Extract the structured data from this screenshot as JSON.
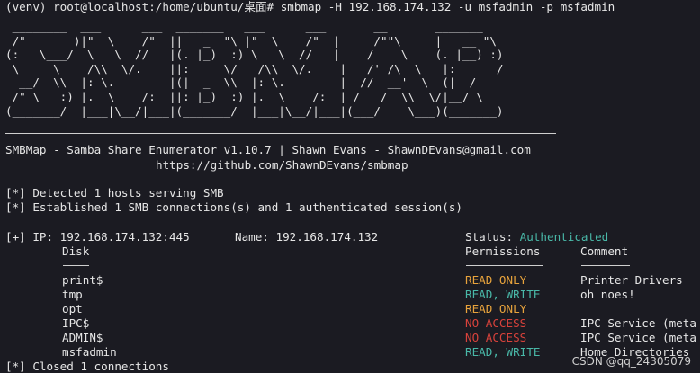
{
  "terminal": {
    "command_line": "(venv) root@localhost:/home/ubuntu/桌面# smbmap -H 192.168.174.132 -u msfadmin -p msfadmin",
    "banner_art": " ________  ___      ___  _______   ___      ___       __       _______\n /\"       )|\"  \\    /\"  ||   _  \"\\ |\"  \\    /\"  |     /\"\"\\     |   __ \"\\\n(:   \\___/  \\   \\  //   |(. |_)  :) \\   \\  //   |    /    \\    (. |__) :)\n \\___  \\    /\\\\  \\/.    ||:     \\/   /\\\\  \\/.    |   /' /\\  \\   |:  ____/\n  __/  \\\\  |: \\.        |(|  _  \\\\  |: \\.        |  //  __'  \\  (|  /\n /\" \\   :) |.  \\    /:  ||: |_)  :) |.  \\    /:  | /   /  \\\\  \\/|__/ \\\n(_______/  |___|\\__/|___|(_______/  |___|\\__/|___|(___/    \\___)(_______)",
    "title_line": "SMBMap - Samba Share Enumerator v1.10.7 | Shawn Evans - ShawnDEvans@gmail.com",
    "url_line": "https://github.com/ShawnDEvans/smbmap",
    "detect_line": "[*] Detected 1 hosts serving SMB",
    "session_line": "[*] Established 1 SMB connections(s) and 1 authenticated session(s)",
    "host": {
      "ip_text": "[+] IP: 192.168.174.132:445",
      "name_text": "Name: 192.168.174.132",
      "status_label": "Status: ",
      "status_value": "Authenticated",
      "status_color": "#49b8a8"
    },
    "table": {
      "headers": {
        "disk": "Disk",
        "permissions": "Permissions",
        "comment": "Comment"
      },
      "rows": [
        {
          "disk": "print$",
          "permissions": "READ ONLY",
          "perm_color": "#e8a33c",
          "comment": "Printer Drivers"
        },
        {
          "disk": "tmp",
          "permissions": "READ, WRITE",
          "perm_color": "#49b8a8",
          "comment": "oh noes!"
        },
        {
          "disk": "opt",
          "permissions": "READ ONLY",
          "perm_color": "#e8a33c",
          "comment": ""
        },
        {
          "disk": "IPC$",
          "permissions": "NO ACCESS",
          "perm_color": "#d8423b",
          "comment": "IPC Service (meta"
        },
        {
          "disk": "ADMIN$",
          "permissions": "NO ACCESS",
          "perm_color": "#d8423b",
          "comment": "IPC Service (meta"
        },
        {
          "disk": "msfadmin",
          "permissions": "READ, WRITE",
          "perm_color": "#49b8a8",
          "comment": "Home Directories"
        }
      ]
    },
    "closed_line": "[*] Closed 1 connections",
    "watermark": "CSDN @qq_24305079"
  }
}
